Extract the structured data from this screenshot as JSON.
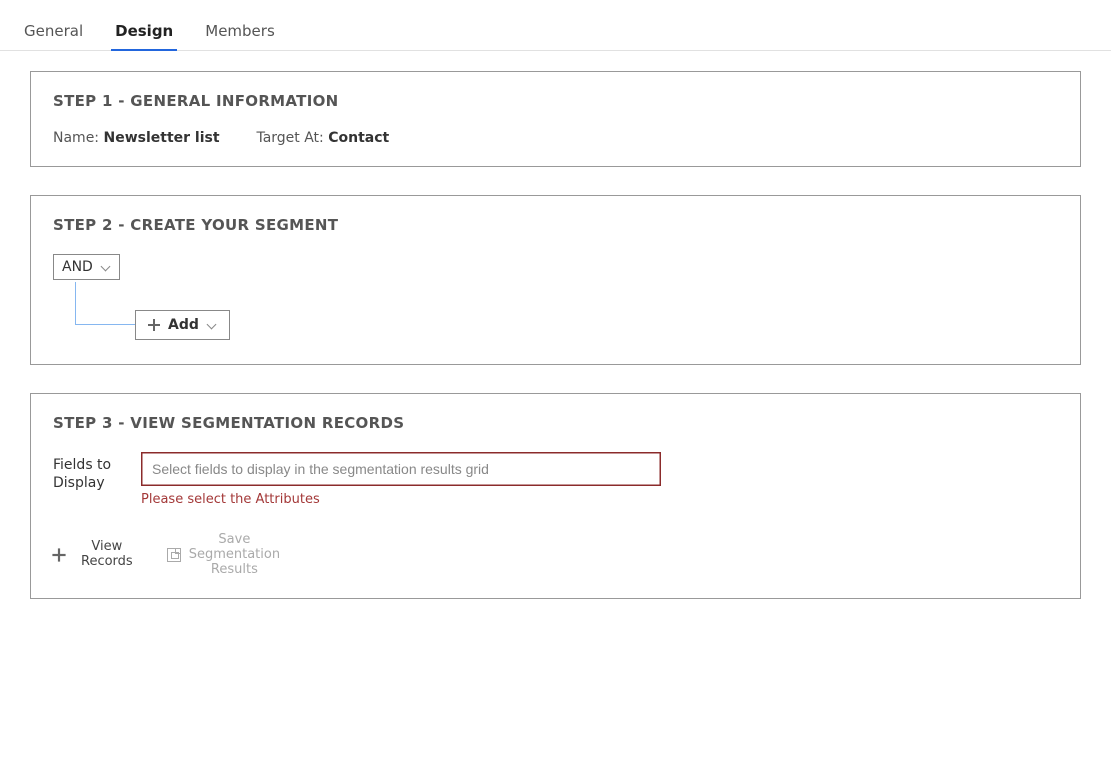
{
  "tabs": [
    {
      "label": "General",
      "active": false
    },
    {
      "label": "Design",
      "active": true
    },
    {
      "label": "Members",
      "active": false
    }
  ],
  "step1": {
    "title": "STEP 1 - GENERAL INFORMATION",
    "name_label": "Name:",
    "name_value": "Newsletter list",
    "target_label": "Target At:",
    "target_value": "Contact"
  },
  "step2": {
    "title": "STEP 2 - CREATE YOUR SEGMENT",
    "group_operator": "AND",
    "add_label": "Add"
  },
  "step3": {
    "title": "STEP 3 - VIEW SEGMENTATION RECORDS",
    "fields_label": "Fields to Display",
    "fields_placeholder": "Select fields to display in the segmentation results grid",
    "fields_value": "",
    "fields_error": "Please select the Attributes",
    "view_records_label": "View\nRecords",
    "save_results_label": "Save\nSegmentation\nResults"
  }
}
